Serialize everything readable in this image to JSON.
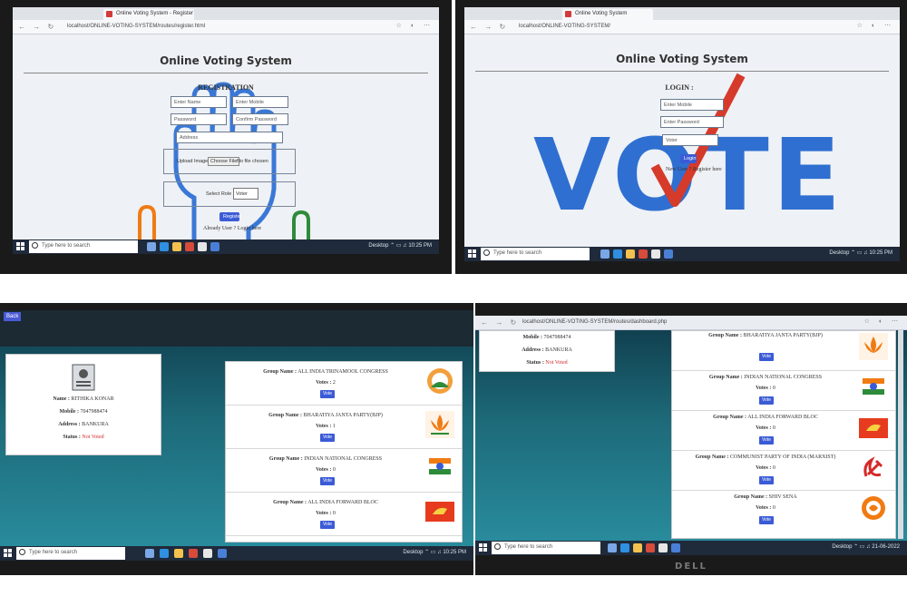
{
  "common": {
    "app_title": "Online Voting System",
    "url_prefix": "localhost/ONLINE-VOTING-SYSTEM/"
  },
  "registration": {
    "tab_title": "Online Voting System - Register",
    "url": "localhost/ONLINE-VOTING-SYSTEM/routes/register.html",
    "heading": "REGISTRATION",
    "name_placeholder": "Enter Name",
    "mobile_placeholder": "Enter Mobile",
    "password_placeholder": "Password",
    "confirm_placeholder": "Confirm Password",
    "address_placeholder": "Address",
    "upload_label": "Upload Image",
    "choose_file": "Choose File",
    "no_file": "No file chosen",
    "role_label": "Select Role",
    "role_value": "Voter",
    "register_button": "Register",
    "already_user": "Already User ?",
    "login_link": "Login here"
  },
  "login": {
    "tab_title": "Online Voting System",
    "url": "localhost/ONLINE-VOTING-SYSTEM/",
    "heading": "LOGIN",
    "mobile_placeholder": "Enter Mobile",
    "password_placeholder": "Enter Password",
    "role_value": "Voter",
    "login_button": "Login",
    "new_user": "New User ?",
    "register_link": "Register here",
    "watermark": "VOTE"
  },
  "dashboard": {
    "url": "localhost/ONLINE-VOTING-SYSTEM/routes/dashboard.php",
    "profile": {
      "name_label": "Name :",
      "name_value": "RITHIKA KONAR",
      "mobile_label": "Mobile :",
      "mobile_value": "7047988474",
      "address_label": "Address :",
      "address_value": "BANKURA",
      "status_label": "Status :",
      "status_value": "Not Voted"
    },
    "group_label": "Group Name :",
    "votes_label": "Votes :",
    "vote_button": "Vote",
    "groups": [
      {
        "name": "ALL INDIA TRINAMOOL CONGRESS",
        "votes": "2"
      },
      {
        "name": "BHARATIYA JANTA PARTY(BJP)",
        "votes": "1"
      },
      {
        "name": "INDIAN NATIONAL CONGRESS",
        "votes": "0"
      },
      {
        "name": "ALL INDIA FORWARD BLOC",
        "votes": "0"
      },
      {
        "name": "COMMUNIST PARTY OF INDIA (MARXIST)",
        "votes": "0"
      },
      {
        "name": "SHIV SENA",
        "votes": "0"
      }
    ],
    "scrolled_party_names": [
      "BHARATIYA JANTA PARTY(BJP)",
      "INDIAN NATIONAL CONGRESS",
      "ALL INDIA FORWARD BLOC",
      "COMMUNIST PARTY OF INDIA (MARXIST)",
      "SHIV SENA"
    ]
  },
  "taskbar": {
    "search_placeholder": "Type here to search",
    "desktop_label": "Desktop",
    "clock": "10:25 PM",
    "date": "21-06-2022"
  },
  "monitor_brand": "DELL",
  "colors": {
    "accent_blue": "#3b5bd6",
    "vote_blue": "#2f6fd1",
    "check_red": "#d63a2a",
    "status_red": "#d62828",
    "tmc_green": "#2e8b3a",
    "bjp_orange": "#f07b13"
  }
}
